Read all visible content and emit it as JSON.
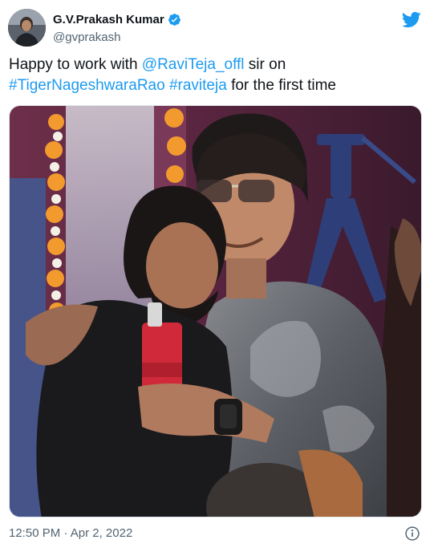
{
  "author": {
    "display_name": "G.V.Prakash Kumar",
    "handle": "@gvprakash",
    "verified": true,
    "avatar_icon": "profile-photo"
  },
  "tweet": {
    "text_parts": {
      "p1": "Happy to work with ",
      "p2": "@RaviTeja_offl",
      "p3": " sir on",
      "p4": "#TigerNageshwaraRao",
      "p5": " ",
      "p6": "#raviteja",
      "p7": " for the first time"
    }
  },
  "footer": {
    "time": "12:50 PM",
    "separator": " · ",
    "date": "Apr 2, 2022"
  },
  "icons": {
    "brand": "twitter-bird-icon",
    "verified": "verified-badge-icon",
    "info": "info-icon"
  },
  "colors": {
    "link": "#1d9bf0",
    "text": "#0f1419",
    "secondary": "#536471",
    "twitter_blue": "#1d9bf0"
  }
}
